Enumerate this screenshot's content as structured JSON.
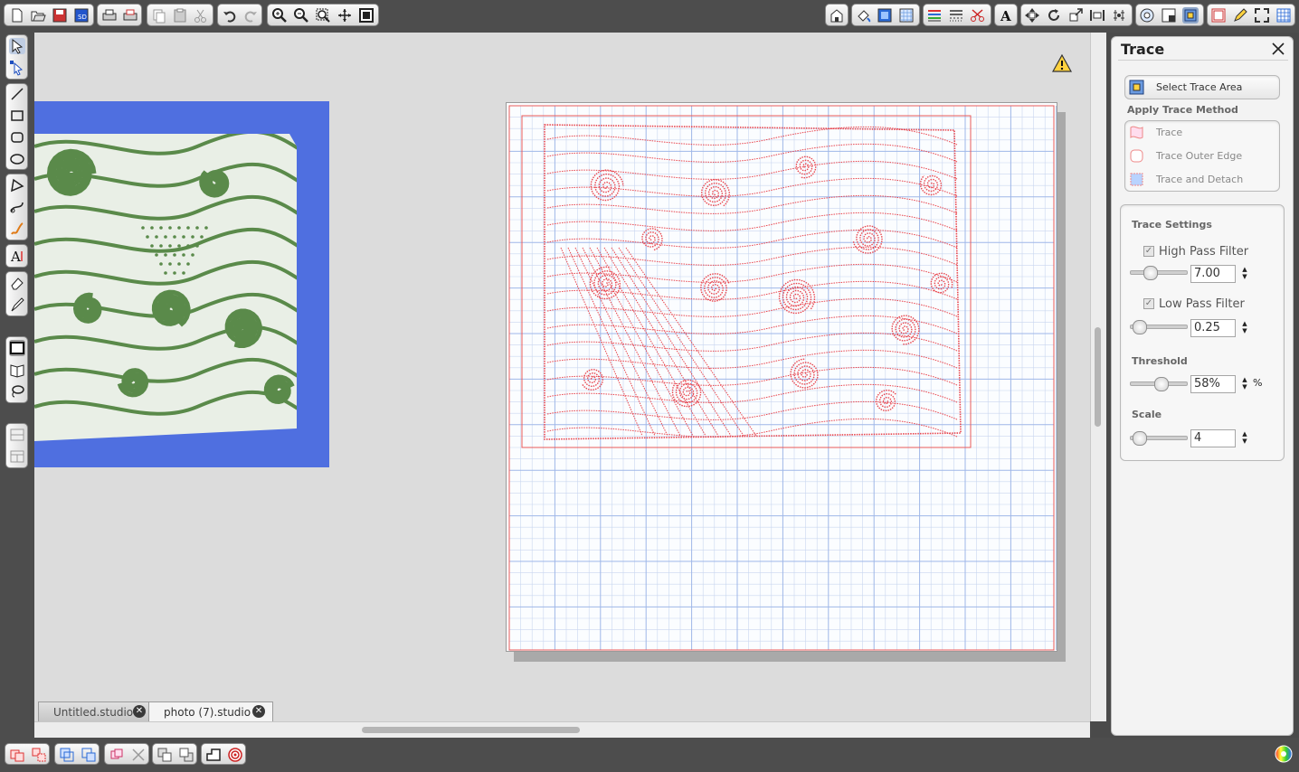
{
  "toolbar": {
    "left_icons": [
      "new-document-icon",
      "open-icon",
      "save-icon",
      "save-to-library-icon",
      "print-icon",
      "print-cut-icon",
      "copy-icon",
      "paste-icon",
      "cut-icon",
      "undo-icon",
      "redo-icon",
      "zoom-in-icon",
      "zoom-out-icon",
      "zoom-select-icon",
      "pan-icon",
      "fit-to-page-icon"
    ],
    "right_icons": [
      "library-icon",
      "fill-color-icon",
      "line-color-icon",
      "pattern-icon",
      "line-style-icon",
      "line-type-icon",
      "cut-style-icon",
      "text-style-icon",
      "transform-icon",
      "rotate-icon",
      "scale-icon",
      "align-icon",
      "replicate-icon",
      "offset-icon",
      "trace-icon",
      "page-setup-icon",
      "cut-settings-icon",
      "sketch-icon",
      "full-screen-icon",
      "grid-icon"
    ]
  },
  "tools": [
    "select-icon",
    "point-edit-icon",
    "line-icon",
    "rectangle-icon",
    "rounded-rectangle-icon",
    "ellipse-icon",
    "polygon-icon",
    "curve-icon",
    "freehand-icon",
    "text-icon",
    "eraser-icon",
    "knife-icon",
    "fill-icon",
    "library-panel-icon",
    "lasso-icon",
    "layout-a-icon",
    "layout-b-icon"
  ],
  "warning": {
    "icon": "warning-icon"
  },
  "tabs": [
    {
      "label": "Untitled.studio"
    },
    {
      "label": "photo (7).studio"
    }
  ],
  "panel": {
    "title": "Trace",
    "select_area": "Select Trace Area",
    "apply_method_label": "Apply Trace Method",
    "methods": [
      "Trace",
      "Trace Outer Edge",
      "Trace and Detach"
    ],
    "settings_label": "Trace Settings",
    "high_pass": {
      "label": "High Pass Filter",
      "checked": true,
      "value": "7.00",
      "level": 0.28
    },
    "low_pass": {
      "label": "Low Pass Filter",
      "checked": true,
      "value": "0.25",
      "level": 0.05
    },
    "threshold": {
      "label": "Threshold",
      "value": "58%",
      "unit": "%",
      "level": 0.5
    },
    "scale": {
      "label": "Scale",
      "value": "4",
      "level": 0.05
    }
  },
  "colors": {
    "accent": "#e85a5a",
    "grid": "#9fb7e8",
    "photo_bg": "#4f6fe0",
    "doodle": "#5a8a4a"
  }
}
